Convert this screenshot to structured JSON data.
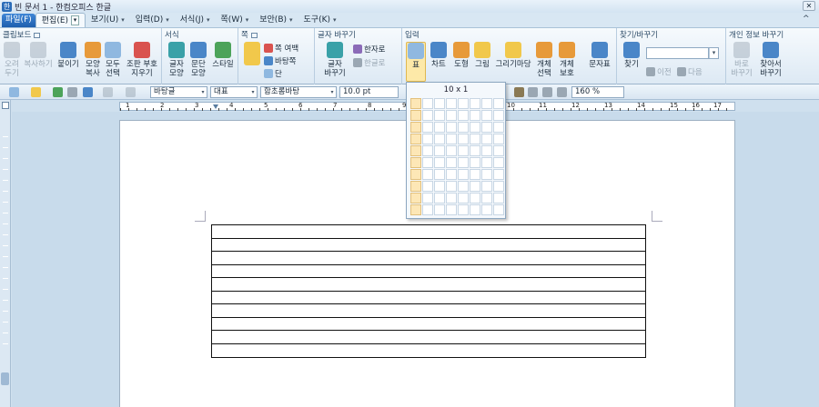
{
  "titlebar": {
    "icon_glyph": "한",
    "title": "빈 문서 1 - 한컴오피스 한글",
    "close_glyph": "✕"
  },
  "menubar": {
    "file": "파일(F)",
    "tabs": [
      {
        "label": "편집(E)",
        "active": true
      },
      {
        "label": "보기(U)"
      },
      {
        "label": "입력(D)"
      },
      {
        "label": "서식(J)"
      },
      {
        "label": "쪽(W)"
      },
      {
        "label": "보안(B)"
      },
      {
        "label": "도구(K)"
      }
    ],
    "dropdown_glyph": "▾",
    "collapse_glyph": "^"
  },
  "ribbon": {
    "groups": {
      "clipboard": "클립보드",
      "format": "서식",
      "page": "쪽",
      "char_change": "글자 바꾸기",
      "insert": "입력",
      "find": "찾기/바꾸기",
      "privacy": "개인 정보 바꾸기"
    },
    "buttons": {
      "cut": "오려\n두기",
      "copy": "복사하기",
      "paste": "붙이기",
      "shape_copy": "모양\n복사",
      "select_all": "모두\n선택",
      "cond_delete": "조판 부호\n지우기",
      "char_shape": "글자\n모양",
      "para_shape": "문단\n모양",
      "style": "스타일",
      "page_margin": "쪽 여백",
      "background": "바탕쪽",
      "columns": "단",
      "char_change": "글자\n바꾸기",
      "hanja": "한자로",
      "hangul": "한글로",
      "table": "표",
      "chart": "차트",
      "shape": "도형",
      "picture": "그림",
      "draw": "그리기마당",
      "obj_select": "개체\n선택",
      "obj_protect": "개체\n보호",
      "symbols": "문자표",
      "find": "찾기",
      "prev": "이전",
      "next": "다음",
      "privacy_change": "바로\n바꾸기",
      "privacy_find": "찾아서\n바꾸기"
    },
    "find_input_value": ""
  },
  "toolbar": {
    "style": "바탕글",
    "lang": "대표",
    "font": "함초롬바탕",
    "size": "10.0",
    "size_unit": "pt",
    "zoom": "160",
    "zoom_unit": "%"
  },
  "ruler": {
    "numbers": [
      "1",
      "2",
      "3",
      "4",
      "5",
      "6",
      "7",
      "8",
      "9",
      "10",
      "11",
      "12",
      "13",
      "14",
      "15",
      "16",
      "17"
    ]
  },
  "table_popup": {
    "caption": "10 x 1",
    "rows": 10,
    "cols": 8,
    "selected_rows": 10,
    "selected_cols": 1
  },
  "document": {
    "table_rows": 10,
    "table_cols": 1
  }
}
